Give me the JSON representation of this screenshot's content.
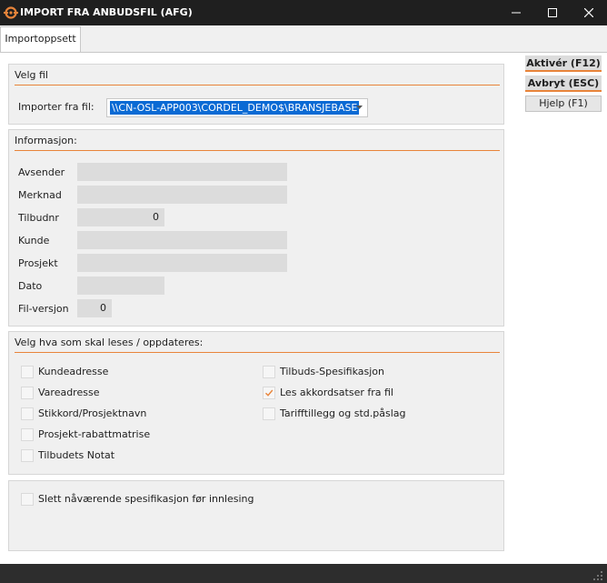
{
  "window": {
    "title": "IMPORT FRA ANBUDSFIL (AFG)",
    "minimize_glyph": "─",
    "maximize_glyph": "☐",
    "close_glyph": "✕"
  },
  "tabs": [
    {
      "label": "Importoppsett",
      "active": true
    }
  ],
  "velg_fil": {
    "title": "Velg fil",
    "label": "Importer fra fil:",
    "value": "\\\\CN-OSL-APP003\\CORDEL_DEMO$\\BRANSJEBASE"
  },
  "informasjon": {
    "title": "Informasjon:",
    "fields": [
      {
        "label": "Avsender",
        "value": ""
      },
      {
        "label": "Merknad",
        "value": ""
      },
      {
        "label": "Tilbudnr",
        "value": "0"
      },
      {
        "label": "Kunde",
        "value": ""
      },
      {
        "label": "Prosjekt",
        "value": ""
      },
      {
        "label": "Dato",
        "value": ""
      },
      {
        "label": "Fil-versjon",
        "value": "0"
      }
    ]
  },
  "les_oppdater": {
    "title": "Velg hva som skal leses / oppdateres:",
    "left": [
      {
        "label": "Kundeadresse",
        "checked": false
      },
      {
        "label": "Vareadresse",
        "checked": false
      },
      {
        "label": "Stikkord/Prosjektnavn",
        "checked": false
      },
      {
        "label": "Prosjekt-rabattmatrise",
        "checked": false
      },
      {
        "label": "Tilbudets Notat",
        "checked": false
      }
    ],
    "right": [
      {
        "label": "Tilbuds-Spesifikasjon",
        "checked": false
      },
      {
        "label": "Les akkordsatser fra fil",
        "checked": true
      },
      {
        "label": "Tarifftillegg og std.påslag",
        "checked": false
      }
    ]
  },
  "slett": {
    "label": "Slett nåværende spesifikasjon før innlesing",
    "checked": false
  },
  "side_buttons": {
    "activate": "Aktivér (F12)",
    "cancel": "Avbryt (ESC)",
    "help": "Hjelp (F1)"
  },
  "colors": {
    "titlebar": "#1f1f1f",
    "accent": "#e8843a",
    "selection": "#0a6ad4",
    "panel": "#f0f0f0",
    "field": "#dcdcdc"
  }
}
